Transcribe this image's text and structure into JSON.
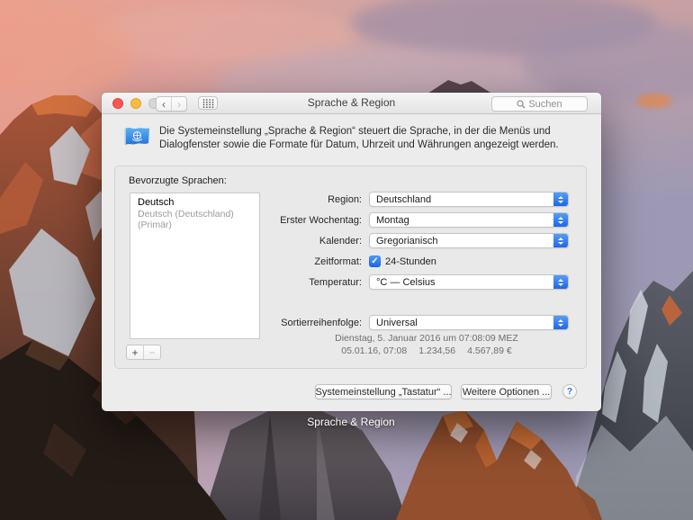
{
  "desktop": {
    "caption": "Sprache & Region"
  },
  "window": {
    "titlebar": {
      "title": "Sprache & Region",
      "search_placeholder": "Suchen"
    },
    "header": {
      "description": "Die Systemeinstellung „Sprache & Region“ steuert die Sprache, in der die Menüs und Dialogfenster sowie die Formate für Datum, Uhrzeit und Währungen angezeigt werden."
    },
    "languages": {
      "label": "Bevorzugte Sprachen:",
      "items": [
        {
          "name": "Deutsch",
          "detail": "Deutsch (Deutschland) (Primär)"
        }
      ]
    },
    "form": {
      "rows": [
        {
          "label": "Region:",
          "value": "Deutschland"
        },
        {
          "label": "Erster Wochentag:",
          "value": "Montag"
        },
        {
          "label": "Kalender:",
          "value": "Gregorianisch"
        },
        {
          "label": "Zeitformat:",
          "value": "24-Stunden",
          "checked": true
        },
        {
          "label": "Temperatur:",
          "value": "°C — Celsius"
        },
        {
          "label": "Sortierreihenfolge:",
          "value": "Universal"
        }
      ],
      "preview": {
        "line1": "Dienstag, 5. Januar 2016 um 07:08:09 MEZ",
        "line2_parts": [
          "05.01.16, 07:08",
          "1.234,56",
          "4.567,89 €"
        ]
      }
    },
    "footer": {
      "keyboard_button": "Systemeinstellung „Tastatur“ ...",
      "options_button": "Weitere Optionen ...",
      "help_button": "?"
    }
  },
  "icons": {
    "back": "‹",
    "forward": "›",
    "add": "+",
    "remove": "−",
    "check": "✓"
  },
  "colors": {
    "accent_blue": "#2d6fe3",
    "traffic_red": "#fc5753",
    "traffic_yellow": "#fdbc40",
    "traffic_disabled": "#d7d6d6"
  }
}
